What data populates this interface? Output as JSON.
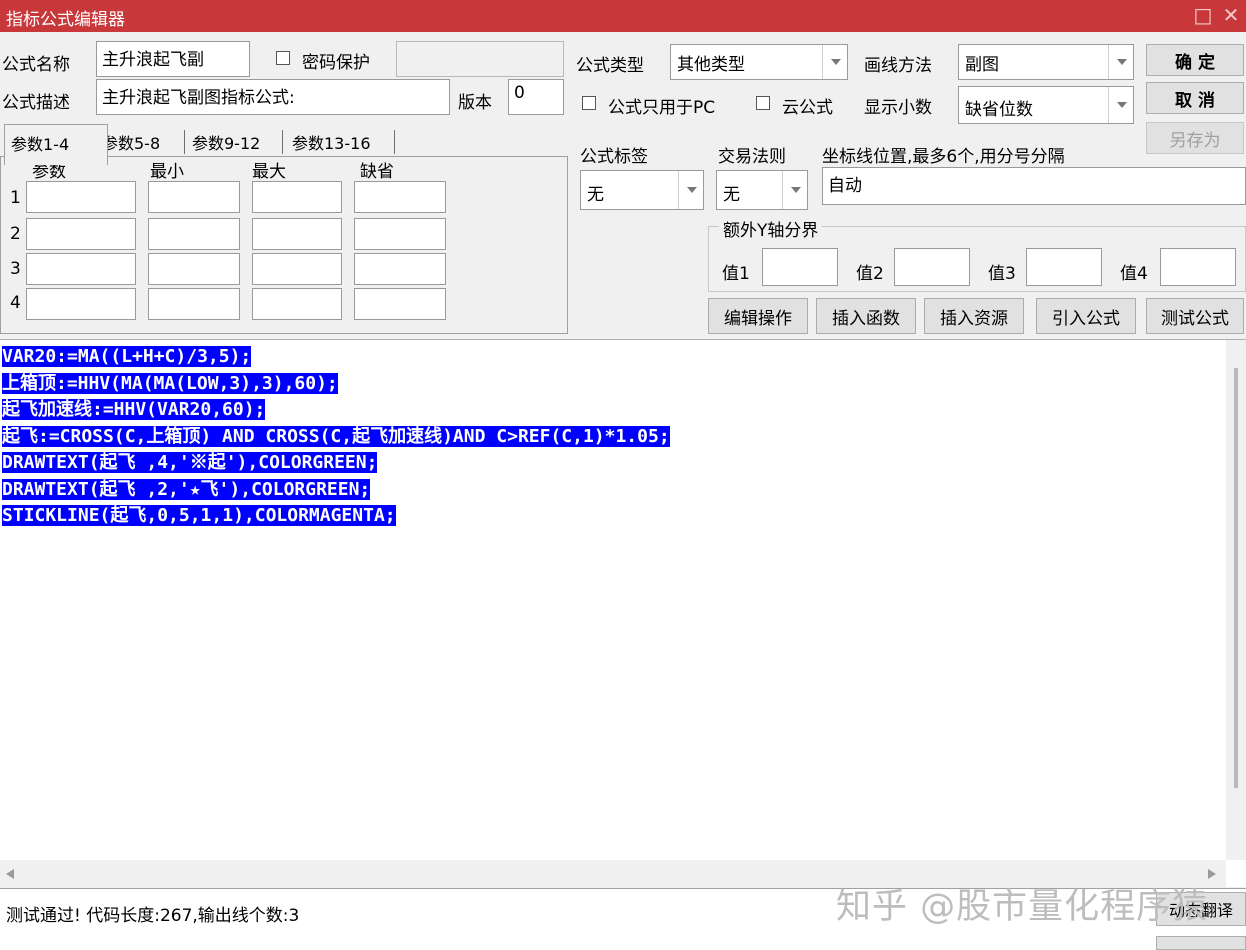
{
  "window": {
    "title": "指标公式编辑器",
    "restore_glyph": "□",
    "close_glyph": "✕"
  },
  "form": {
    "name_label": "公式名称",
    "name_value": "主升浪起飞副",
    "password_label": "密码保护",
    "password_value": "",
    "desc_label": "公式描述",
    "desc_value": "主升浪起飞副图指标公式:",
    "version_label": "版本",
    "version_value": "0",
    "type_label": "公式类型",
    "type_value": "其他类型",
    "draw_label": "画线方法",
    "draw_value": "副图",
    "pc_only_label": "公式只用于PC",
    "cloud_label": "云公式",
    "decimals_label": "显示小数",
    "decimals_value": "缺省位数",
    "tag_label": "公式标签",
    "tag_value": "无",
    "trade_label": "交易法则",
    "trade_value": "无",
    "coord_label": "坐标线位置,最多6个,用分号分隔",
    "coord_value": "自动",
    "yaxis_group": "额外Y轴分界",
    "y_labels": [
      "值1",
      "值2",
      "值3",
      "值4"
    ]
  },
  "buttons": {
    "ok": "确  定",
    "cancel": "取  消",
    "save_as": "另存为"
  },
  "tabs": [
    "参数1-4",
    "参数5-8",
    "参数9-12",
    "参数13-16"
  ],
  "param_headers": [
    "参数",
    "最小",
    "最大",
    "缺省"
  ],
  "param_rows": [
    "1",
    "2",
    "3",
    "4"
  ],
  "toolbar": [
    "编辑操作",
    "插入函数",
    "插入资源",
    "引入公式",
    "测试公式"
  ],
  "code_lines": [
    "VAR20:=MA((L+H+C)/3,5);",
    "上箱顶:=HHV(MA(MA(LOW,3),3),60);",
    "起飞加速线:=HHV(VAR20,60);",
    "起飞:=CROSS(C,上箱顶) AND CROSS(C,起飞加速线)AND C>REF(C,1)*1.05;",
    "DRAWTEXT(起飞 ,4,'※起'),COLORGREEN;",
    "DRAWTEXT(起飞 ,2,'★飞'),COLORGREEN;",
    "STICKLINE(起飞,0,5,1,1),COLORMAGENTA;"
  ],
  "status": {
    "message": "测试通过! 代码长度:267,输出线个数:3",
    "right_button": "动态翻译"
  },
  "watermark": "知乎 @股市量化程序猿",
  "colors": {
    "titlebar": "#c8383a",
    "selection": "#0000ff"
  }
}
